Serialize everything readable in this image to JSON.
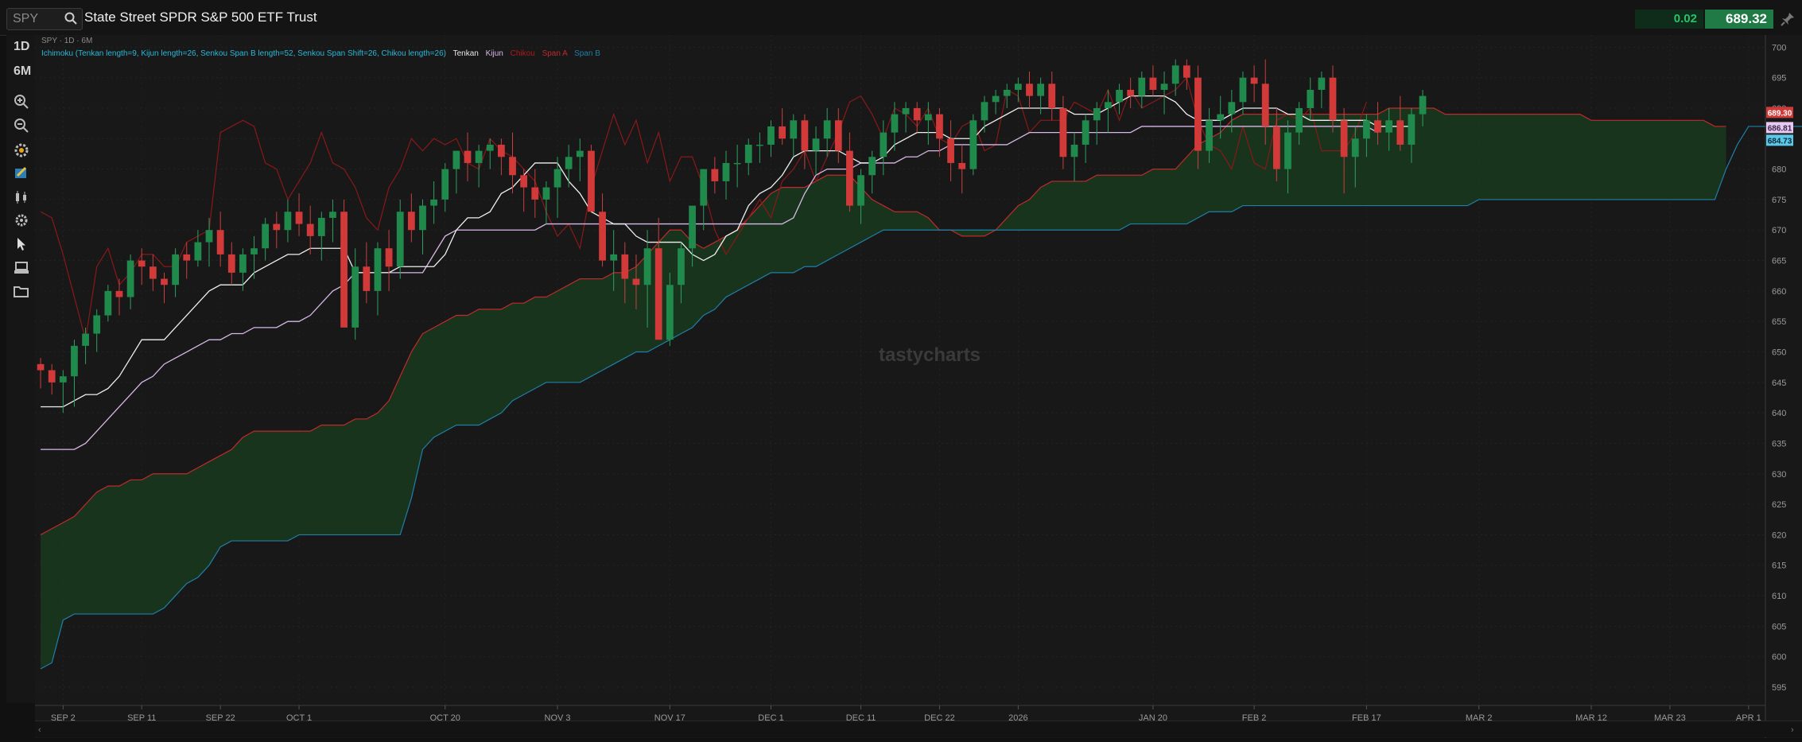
{
  "header": {
    "symbol": "SPY",
    "title": "State Street SPDR S&P 500 ETF Trust",
    "change": "0.02",
    "price": "689.32"
  },
  "sidebar": {
    "items": [
      {
        "label": "1D",
        "icon": null
      },
      {
        "label": "6M",
        "icon": null
      },
      {
        "label": "",
        "icon": "zoom-in-icon"
      },
      {
        "label": "",
        "icon": "zoom-out-icon"
      },
      {
        "label": "",
        "icon": "studies-icon"
      },
      {
        "label": "",
        "icon": "drawing-icon"
      },
      {
        "label": "",
        "icon": "chart-type-icon"
      },
      {
        "label": "",
        "icon": "settings-icon"
      },
      {
        "label": "",
        "icon": "cursor-icon"
      },
      {
        "label": "",
        "icon": "layout-icon"
      },
      {
        "label": "",
        "icon": "folder-icon"
      }
    ]
  },
  "chart_info": "SPY · 1D · 6M",
  "study": {
    "text": "Ichimoku (Tenkan length=9, Kijun length=26, Senkou Span B length=52, Senkou Span Shift=26, Chikou length=26)",
    "legend": [
      {
        "name": "Tenkan",
        "color": "#e8e8e8"
      },
      {
        "name": "Kijun",
        "color": "#d8b8e8"
      },
      {
        "name": "Chikou",
        "color": "#b01a1a"
      },
      {
        "name": "Span A",
        "color": "#c02a2a"
      },
      {
        "name": "Span B",
        "color": "#1e7fa8"
      }
    ]
  },
  "watermark": "tastycharts",
  "price_tags": [
    {
      "label": "689.30",
      "value": 689.3,
      "bg": "#d23a3a",
      "fg": "#ffffff"
    },
    {
      "label": "686.81",
      "value": 686.81,
      "bg": "#e8c8f0",
      "fg": "#3a2a4a"
    },
    {
      "label": "684.73",
      "value": 684.73,
      "bg": "#5bc8e8",
      "fg": "#0a2a3a"
    }
  ],
  "chart_data": {
    "type": "candlestick",
    "title": "",
    "y_range": [
      592,
      702
    ],
    "y_ticks": [
      595,
      600,
      605,
      610,
      615,
      620,
      625,
      630,
      635,
      640,
      645,
      650,
      655,
      660,
      665,
      670,
      675,
      680,
      685,
      690,
      695,
      700
    ],
    "x_ticks": [
      {
        "label": "SEP 2",
        "index": 2
      },
      {
        "label": "SEP 11",
        "index": 9
      },
      {
        "label": "SEP 22",
        "index": 16
      },
      {
        "label": "OCT 1",
        "index": 23
      },
      {
        "label": "OCT 20",
        "index": 36
      },
      {
        "label": "NOV 3",
        "index": 46
      },
      {
        "label": "NOV 17",
        "index": 56
      },
      {
        "label": "DEC 1",
        "index": 65
      },
      {
        "label": "DEC 11",
        "index": 73
      },
      {
        "label": "DEC 22",
        "index": 80
      },
      {
        "label": "2026",
        "index": 87
      },
      {
        "label": "JAN 20",
        "index": 99
      },
      {
        "label": "FEB 2",
        "index": 108
      },
      {
        "label": "FEB 17",
        "index": 118
      },
      {
        "label": "MAR 2",
        "index": 128
      },
      {
        "label": "MAR 12",
        "index": 138
      },
      {
        "label": "MAR 23",
        "index": 145
      },
      {
        "label": "APR 1",
        "index": 152
      }
    ],
    "total_slots": 154,
    "ohlc": [
      [
        648,
        649,
        644,
        647
      ],
      [
        647,
        648,
        643,
        645
      ],
      [
        645,
        647,
        640,
        646
      ],
      [
        646,
        652,
        641,
        651
      ],
      [
        651,
        654,
        648,
        653
      ],
      [
        653,
        657,
        650,
        656
      ],
      [
        656,
        661,
        655,
        660
      ],
      [
        660,
        662,
        656,
        659
      ],
      [
        659,
        666,
        657,
        665
      ],
      [
        665,
        667,
        661,
        664
      ],
      [
        664,
        666,
        660,
        662
      ],
      [
        662,
        663,
        658,
        661
      ],
      [
        661,
        667,
        659,
        666
      ],
      [
        666,
        668,
        662,
        665
      ],
      [
        665,
        670,
        664,
        668
      ],
      [
        668,
        672,
        664,
        670
      ],
      [
        670,
        673,
        664,
        666
      ],
      [
        666,
        668,
        661,
        663
      ],
      [
        663,
        667,
        660,
        666
      ],
      [
        666,
        669,
        662,
        667
      ],
      [
        667,
        672,
        665,
        671
      ],
      [
        671,
        673,
        667,
        670
      ],
      [
        670,
        675,
        668,
        673
      ],
      [
        673,
        676,
        669,
        671
      ],
      [
        671,
        674,
        666,
        669
      ],
      [
        669,
        673,
        665,
        672
      ],
      [
        672,
        675,
        668,
        673
      ],
      [
        673,
        675,
        660,
        654
      ],
      [
        654,
        667,
        652,
        664
      ],
      [
        664,
        668,
        658,
        660
      ],
      [
        660,
        668,
        656,
        667
      ],
      [
        667,
        670,
        660,
        664
      ],
      [
        664,
        675,
        662,
        673
      ],
      [
        673,
        676,
        668,
        670
      ],
      [
        670,
        675,
        666,
        674
      ],
      [
        674,
        678,
        671,
        675
      ],
      [
        675,
        681,
        673,
        680
      ],
      [
        680,
        683,
        676,
        683
      ],
      [
        683,
        686,
        678,
        681
      ],
      [
        681,
        684,
        677,
        683
      ],
      [
        683,
        685,
        680,
        684
      ],
      [
        684,
        685,
        679,
        682
      ],
      [
        682,
        686,
        676,
        679
      ],
      [
        679,
        680,
        673,
        677
      ],
      [
        677,
        680,
        672,
        675
      ],
      [
        675,
        678,
        671,
        677
      ],
      [
        677,
        682,
        672,
        680
      ],
      [
        680,
        684,
        677,
        682
      ],
      [
        682,
        685,
        678,
        683
      ],
      [
        683,
        684,
        673,
        673
      ],
      [
        673,
        676,
        664,
        665
      ],
      [
        665,
        670,
        660,
        666
      ],
      [
        666,
        668,
        658,
        662
      ],
      [
        662,
        666,
        657,
        661
      ],
      [
        661,
        670,
        654,
        667
      ],
      [
        667,
        672,
        652,
        652
      ],
      [
        652,
        663,
        651,
        661
      ],
      [
        661,
        668,
        658,
        667
      ],
      [
        667,
        672,
        664,
        674
      ],
      [
        674,
        678,
        670,
        680
      ],
      [
        680,
        682,
        676,
        678
      ],
      [
        678,
        683,
        675,
        681
      ],
      [
        681,
        684,
        677,
        681
      ],
      [
        681,
        685,
        679,
        684
      ],
      [
        684,
        686,
        681,
        684
      ],
      [
        684,
        688,
        682,
        687
      ],
      [
        687,
        690,
        684,
        685
      ],
      [
        685,
        689,
        682,
        688
      ],
      [
        688,
        689,
        680,
        683
      ],
      [
        683,
        687,
        679,
        685
      ],
      [
        685,
        690,
        682,
        688
      ],
      [
        688,
        690,
        681,
        683
      ],
      [
        683,
        686,
        673,
        674
      ],
      [
        674,
        680,
        671,
        679
      ],
      [
        679,
        683,
        676,
        682
      ],
      [
        682,
        688,
        679,
        686
      ],
      [
        686,
        691,
        683,
        689
      ],
      [
        689,
        691,
        686,
        690
      ],
      [
        690,
        691,
        686,
        688
      ],
      [
        688,
        691,
        684,
        689
      ],
      [
        689,
        690,
        682,
        685
      ],
      [
        685,
        688,
        678,
        681
      ],
      [
        681,
        684,
        676,
        680
      ],
      [
        680,
        689,
        679,
        688
      ],
      [
        688,
        692,
        686,
        691
      ],
      [
        691,
        693,
        689,
        692
      ],
      [
        692,
        694,
        690,
        693
      ],
      [
        693,
        695,
        691,
        694
      ],
      [
        694,
        696,
        690,
        692
      ],
      [
        692,
        695,
        689,
        694
      ],
      [
        694,
        696,
        688,
        690
      ],
      [
        690,
        692,
        680,
        682
      ],
      [
        682,
        686,
        678,
        684
      ],
      [
        684,
        689,
        681,
        688
      ],
      [
        688,
        691,
        684,
        690
      ],
      [
        690,
        693,
        686,
        691
      ],
      [
        691,
        694,
        689,
        693
      ],
      [
        693,
        695,
        690,
        692
      ],
      [
        692,
        696,
        690,
        695
      ],
      [
        695,
        697,
        692,
        693
      ],
      [
        693,
        696,
        689,
        694
      ],
      [
        694,
        698,
        692,
        697
      ],
      [
        697,
        698,
        693,
        695
      ],
      [
        695,
        697,
        680,
        683
      ],
      [
        683,
        690,
        681,
        688
      ],
      [
        688,
        692,
        685,
        689
      ],
      [
        689,
        693,
        686,
        691
      ],
      [
        691,
        696,
        689,
        695
      ],
      [
        695,
        697,
        691,
        694
      ],
      [
        694,
        698,
        684,
        687
      ],
      [
        687,
        690,
        678,
        680
      ],
      [
        680,
        688,
        676,
        686
      ],
      [
        686,
        691,
        684,
        690
      ],
      [
        690,
        695,
        688,
        693
      ],
      [
        693,
        696,
        690,
        695
      ],
      [
        695,
        697,
        686,
        688
      ],
      [
        688,
        690,
        676,
        682
      ],
      [
        682,
        687,
        677,
        685
      ],
      [
        685,
        689,
        682,
        688
      ],
      [
        688,
        691,
        684,
        686
      ],
      [
        686,
        690,
        683,
        688
      ],
      [
        688,
        692,
        683,
        684
      ],
      [
        684,
        690,
        681,
        689
      ],
      [
        689,
        693,
        687,
        692
      ]
    ],
    "tenkan": [
      641,
      641,
      641,
      642,
      643,
      643,
      644,
      646,
      649,
      652,
      652,
      652,
      654,
      656,
      658,
      660,
      661,
      661,
      661,
      663,
      664,
      665,
      666,
      666,
      667,
      667,
      667,
      667,
      663,
      663,
      663,
      663,
      664,
      664,
      664,
      664,
      666,
      670,
      672,
      672,
      673,
      676,
      677,
      679,
      681,
      681,
      681,
      678,
      676,
      673,
      672,
      671,
      671,
      669,
      668,
      668,
      668,
      668,
      666,
      665,
      666,
      669,
      670,
      674,
      676,
      677,
      679,
      682,
      683,
      683,
      683,
      683,
      682,
      681,
      681,
      682,
      684,
      685,
      686,
      686,
      686,
      685,
      685,
      685,
      687,
      688,
      689,
      690,
      690,
      690,
      690,
      690,
      689,
      689,
      689,
      690,
      691,
      692,
      692,
      692,
      692,
      691,
      689,
      688,
      688,
      688,
      689,
      690,
      690,
      690,
      690,
      689,
      689,
      688,
      688,
      688,
      688,
      688,
      688,
      687,
      687,
      687,
      687
    ],
    "kijun": [
      634,
      634,
      634,
      634,
      635,
      637,
      639,
      641,
      643,
      645,
      646,
      648,
      649,
      650,
      651,
      652,
      652,
      653,
      653,
      654,
      654,
      654,
      655,
      655,
      656,
      658,
      660,
      661,
      663,
      663,
      663,
      663,
      663,
      663,
      663,
      666,
      669,
      670,
      670,
      670,
      670,
      670,
      670,
      670,
      670,
      671,
      671,
      671,
      671,
      671,
      671,
      671,
      671,
      671,
      671,
      671,
      671,
      671,
      671,
      671,
      671,
      671,
      671,
      671,
      671,
      671,
      671,
      672,
      676,
      679,
      680,
      680,
      680,
      681,
      681,
      681,
      681,
      682,
      682,
      683,
      683,
      684,
      684,
      684,
      684,
      684,
      684,
      685,
      686,
      686,
      686,
      686,
      686,
      686,
      686,
      686,
      686,
      686,
      687,
      687,
      687,
      687,
      687,
      687,
      687,
      687,
      687,
      687,
      687,
      687,
      687,
      687,
      687,
      687,
      687,
      687,
      687,
      687,
      687,
      686
    ],
    "chikou": [
      673,
      672,
      666,
      659,
      652,
      664,
      667,
      661,
      663,
      666,
      666,
      664,
      664,
      668,
      669,
      670,
      686,
      687,
      688,
      687,
      681,
      680,
      675,
      678,
      681,
      686,
      681,
      680,
      677,
      672,
      670,
      677,
      680,
      685,
      683,
      685,
      684,
      685,
      681,
      680,
      685,
      683,
      682,
      680,
      678,
      673,
      669,
      671,
      667,
      677,
      683,
      689,
      684,
      688,
      681,
      686,
      678,
      682,
      682,
      677,
      670,
      666,
      669,
      672,
      675,
      672,
      678,
      680,
      683,
      678,
      682,
      686,
      691,
      692,
      689,
      685,
      690,
      689,
      687,
      690,
      685,
      684,
      687,
      688,
      683,
      684,
      693,
      692,
      686,
      688,
      688,
      688,
      691,
      690,
      689,
      693,
      688,
      693,
      690,
      691,
      692,
      693,
      695,
      688,
      684,
      683,
      680,
      687,
      681,
      680,
      688,
      689,
      688,
      690,
      683,
      683,
      683,
      686,
      691
    ],
    "span_a": [
      620,
      621,
      622,
      623,
      625,
      627,
      628,
      628,
      629,
      629,
      630,
      630,
      630,
      630,
      631,
      632,
      633,
      634,
      636,
      637,
      637,
      637,
      637,
      637,
      637,
      638,
      638,
      638,
      639,
      639,
      640,
      642,
      646,
      650,
      653,
      654,
      655,
      656,
      656,
      657,
      657,
      657,
      658,
      658,
      659,
      659,
      660,
      661,
      662,
      662,
      662,
      663,
      663,
      664,
      666,
      668,
      670,
      670,
      668,
      667,
      668,
      669,
      670,
      672,
      674,
      676,
      677,
      677,
      677,
      678,
      679,
      679,
      679,
      677,
      675,
      674,
      673,
      673,
      673,
      672,
      670,
      670,
      669,
      669,
      669,
      670,
      672,
      674,
      675,
      677,
      678,
      678,
      678,
      678,
      679,
      679,
      679,
      679,
      679,
      680,
      680,
      680,
      682,
      684,
      685,
      686,
      688,
      689,
      689,
      689,
      689,
      689,
      689,
      689,
      689,
      689,
      689,
      689,
      689,
      689,
      690,
      690,
      690,
      690,
      690,
      689,
      689,
      689,
      689,
      689,
      689,
      689,
      689,
      689,
      689,
      689,
      689,
      689,
      688,
      688,
      688,
      688,
      688,
      688,
      688,
      688,
      688,
      688,
      688,
      687,
      687
    ],
    "span_b": [
      598,
      599,
      606,
      607,
      607,
      607,
      607,
      607,
      607,
      607,
      607,
      608,
      610,
      612,
      613,
      615,
      618,
      619,
      619,
      619,
      619,
      619,
      619,
      620,
      620,
      620,
      620,
      620,
      620,
      620,
      620,
      620,
      620,
      626,
      634,
      636,
      637,
      638,
      638,
      638,
      639,
      640,
      642,
      643,
      644,
      645,
      645,
      645,
      645,
      646,
      647,
      648,
      649,
      650,
      650,
      651,
      652,
      653,
      654,
      656,
      657,
      659,
      660,
      661,
      662,
      663,
      663,
      663,
      664,
      664,
      665,
      666,
      667,
      668,
      669,
      670,
      670,
      670,
      670,
      670,
      670,
      670,
      670,
      670,
      670,
      670,
      670,
      670,
      670,
      670,
      670,
      670,
      670,
      670,
      670,
      670,
      670,
      671,
      671,
      671,
      671,
      671,
      671,
      672,
      673,
      673,
      673,
      674,
      674,
      674,
      674,
      674,
      674,
      674,
      674,
      674,
      674,
      674,
      674,
      674,
      674,
      674,
      674,
      674,
      674,
      674,
      674,
      674,
      675,
      675,
      675,
      675,
      675,
      675,
      675,
      675,
      675,
      675,
      675,
      675,
      675,
      675,
      675,
      675,
      675,
      675,
      675,
      675,
      675,
      675,
      680,
      684,
      687,
      687,
      687,
      687,
      687,
      687,
      687,
      687,
      687,
      687,
      687,
      687,
      687,
      687,
      687,
      687
    ]
  }
}
